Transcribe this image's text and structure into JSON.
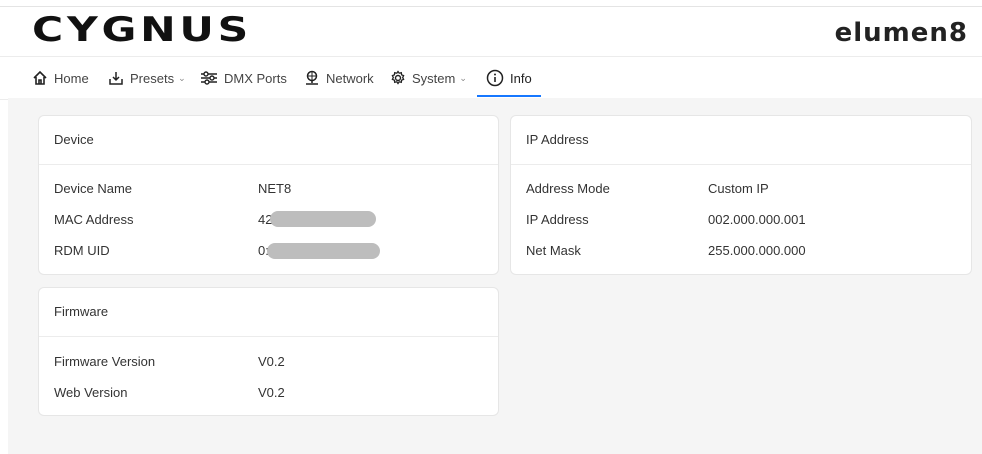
{
  "brand": {
    "left": "CYGNUS",
    "right": "elumen8"
  },
  "nav": {
    "home": "Home",
    "presets": "Presets",
    "dmx": "DMX Ports",
    "network": "Network",
    "system": "System",
    "info": "Info"
  },
  "device": {
    "title": "Device",
    "rows": [
      {
        "label": "Device Name",
        "value": "NET8"
      },
      {
        "label": "MAC Address",
        "value": "42"
      },
      {
        "label": "RDM UID",
        "value": "0:"
      }
    ]
  },
  "ip": {
    "title": "IP Address",
    "rows": [
      {
        "label": "Address Mode",
        "value": "Custom IP"
      },
      {
        "label": "IP Address",
        "value": "002.000.000.001"
      },
      {
        "label": "Net Mask",
        "value": "255.000.000.000"
      }
    ]
  },
  "firmware": {
    "title": "Firmware",
    "rows": [
      {
        "label": "Firmware Version",
        "value": "V0.2"
      },
      {
        "label": "Web Version",
        "value": "V0.2"
      }
    ]
  }
}
